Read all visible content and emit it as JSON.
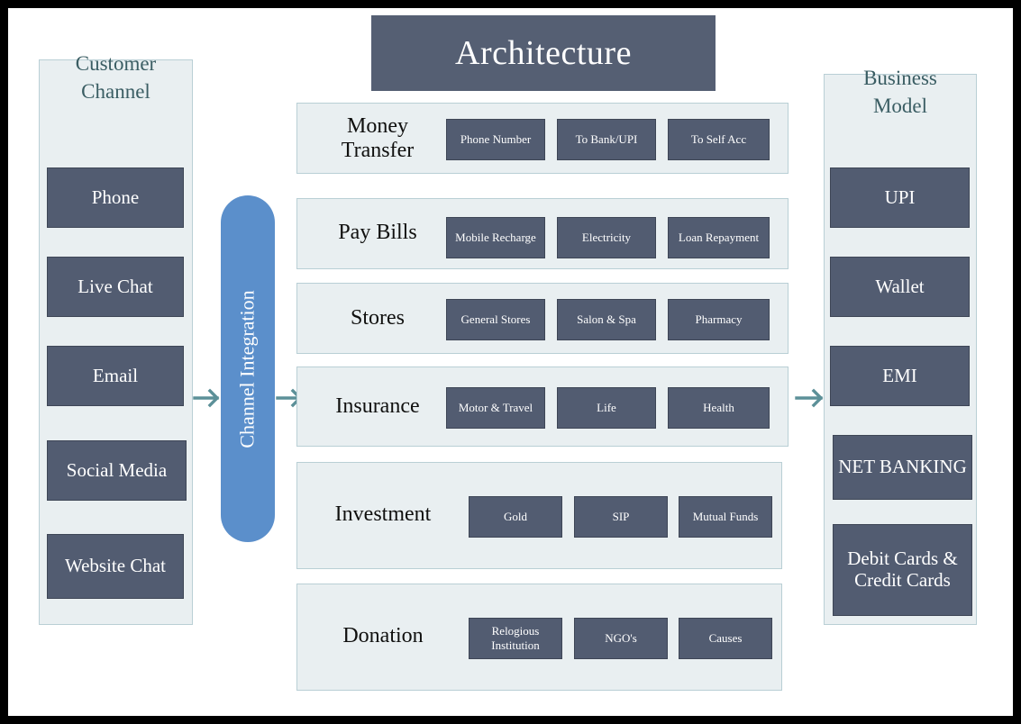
{
  "title": "Architecture",
  "colors": {
    "frame": "#000000",
    "title_bar": "#555F73",
    "card": "#525C71",
    "panel_bg": "#E9EFF1",
    "panel_border": "#B9CFD5",
    "pill": "#5B8FCB",
    "arrow": "#4E8A92",
    "heading_text": "#3A5D63"
  },
  "customer_channel": {
    "heading": "Customer Channel",
    "items": [
      {
        "label": "Phone"
      },
      {
        "label": "Live Chat"
      },
      {
        "label": "Email"
      },
      {
        "label": "Social Media"
      },
      {
        "label": "Website Chat"
      }
    ]
  },
  "channel_integration": {
    "label": "Channel Integration"
  },
  "arrows": {
    "left_arrow": "arrow-right-icon",
    "mid_arrow": "arrow-right-icon",
    "right_arrow": "arrow-right-icon"
  },
  "services": [
    {
      "label": "Money Transfer",
      "chips": [
        "Phone Number",
        "To Bank/UPI",
        "To Self Acc"
      ]
    },
    {
      "label": "Pay Bills",
      "chips": [
        "Mobile Recharge",
        "Electricity",
        "Loan Repayment"
      ]
    },
    {
      "label": "Stores",
      "chips": [
        "General Stores",
        "Salon & Spa",
        "Pharmacy"
      ]
    },
    {
      "label": "Insurance",
      "chips": [
        "Motor & Travel",
        "Life",
        "Health"
      ]
    },
    {
      "label": "Investment",
      "chips": [
        "Gold",
        "SIP",
        "Mutual Funds"
      ]
    },
    {
      "label": "Donation",
      "chips": [
        "Relogious Institution",
        "NGO's",
        "Causes"
      ]
    }
  ],
  "business_model": {
    "heading": "Business Model",
    "items": [
      {
        "label": "UPI"
      },
      {
        "label": "Wallet"
      },
      {
        "label": "EMI"
      },
      {
        "label": "NET BANKING"
      },
      {
        "label": "Debit Cards & Credit Cards"
      }
    ]
  }
}
